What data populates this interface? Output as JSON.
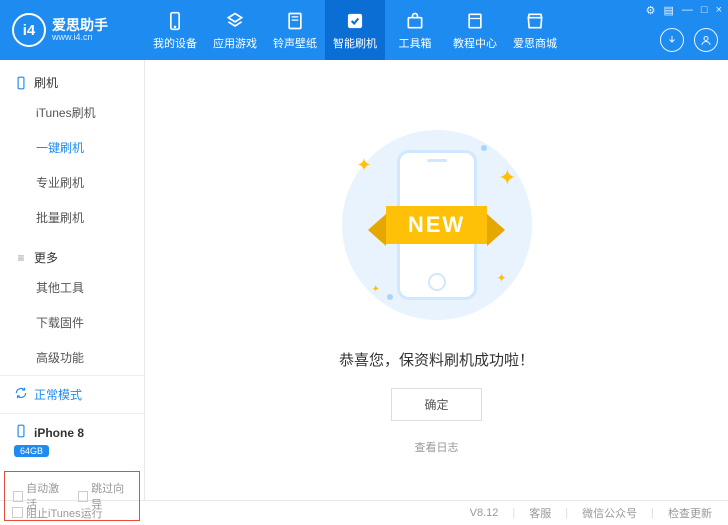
{
  "app": {
    "name": "爱思助手",
    "url": "www.i4.cn",
    "logo_text": "i4"
  },
  "window_controls": {
    "settings": "⚙",
    "menu": "▤",
    "min": "—",
    "max": "□",
    "close": "×"
  },
  "nav": [
    {
      "label": "我的设备",
      "icon": "phone"
    },
    {
      "label": "应用游戏",
      "icon": "apps"
    },
    {
      "label": "铃声壁纸",
      "icon": "music"
    },
    {
      "label": "智能刷机",
      "icon": "flash",
      "active": true
    },
    {
      "label": "工具箱",
      "icon": "toolbox"
    },
    {
      "label": "教程中心",
      "icon": "book"
    },
    {
      "label": "爱思商城",
      "icon": "shop"
    }
  ],
  "sidebar": {
    "section1": {
      "title": "刷机",
      "items": [
        "iTunes刷机",
        "一键刷机",
        "专业刷机",
        "批量刷机"
      ],
      "active_index": 1
    },
    "section2": {
      "title": "更多",
      "items": [
        "其他工具",
        "下载固件",
        "高级功能"
      ]
    },
    "status": "正常模式",
    "device": {
      "name": "iPhone 8",
      "storage": "64GB"
    },
    "checks": {
      "auto_activate": "自动激活",
      "skip_wizard": "跳过向导"
    }
  },
  "main": {
    "ribbon": "NEW",
    "message": "恭喜您，保资料刷机成功啦！",
    "confirm_btn": "确定",
    "log_link": "查看日志"
  },
  "footer": {
    "block_itunes": "阻止iTunes运行",
    "version": "V8.12",
    "support": "客服",
    "wechat": "微信公众号",
    "update": "检查更新"
  }
}
